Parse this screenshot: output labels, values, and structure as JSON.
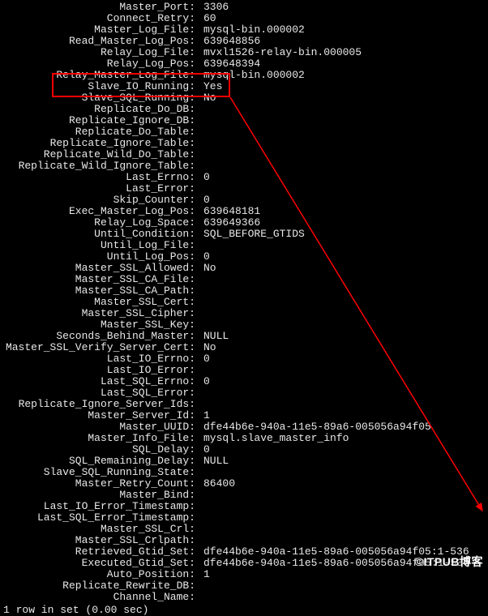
{
  "footer": "1 row in set (0.00 sec)",
  "watermark": "©ITPUB博客",
  "rows": [
    {
      "label": "Master_Port:",
      "value": "3306"
    },
    {
      "label": "Connect_Retry:",
      "value": "60"
    },
    {
      "label": "Master_Log_File:",
      "value": "mysql-bin.000002"
    },
    {
      "label": "Read_Master_Log_Pos:",
      "value": "639648856"
    },
    {
      "label": "Relay_Log_File:",
      "value": "mvxl1526-relay-bin.000005"
    },
    {
      "label": "Relay_Log_Pos:",
      "value": "639648394"
    },
    {
      "label": "Relay_Master_Log_File:",
      "value": "mysql-bin.000002"
    },
    {
      "label": "Slave_IO_Running:",
      "value": "Yes"
    },
    {
      "label": "Slave_SQL_Running:",
      "value": "No"
    },
    {
      "label": "Replicate_Do_DB:",
      "value": ""
    },
    {
      "label": "Replicate_Ignore_DB:",
      "value": ""
    },
    {
      "label": "Replicate_Do_Table:",
      "value": ""
    },
    {
      "label": "Replicate_Ignore_Table:",
      "value": ""
    },
    {
      "label": "Replicate_Wild_Do_Table:",
      "value": ""
    },
    {
      "label": "Replicate_Wild_Ignore_Table:",
      "value": ""
    },
    {
      "label": "Last_Errno:",
      "value": "0"
    },
    {
      "label": "Last_Error:",
      "value": ""
    },
    {
      "label": "Skip_Counter:",
      "value": "0"
    },
    {
      "label": "Exec_Master_Log_Pos:",
      "value": "639648181"
    },
    {
      "label": "Relay_Log_Space:",
      "value": "639649366"
    },
    {
      "label": "Until_Condition:",
      "value": "SQL_BEFORE_GTIDS"
    },
    {
      "label": "Until_Log_File:",
      "value": ""
    },
    {
      "label": "Until_Log_Pos:",
      "value": "0"
    },
    {
      "label": "Master_SSL_Allowed:",
      "value": "No"
    },
    {
      "label": "Master_SSL_CA_File:",
      "value": ""
    },
    {
      "label": "Master_SSL_CA_Path:",
      "value": ""
    },
    {
      "label": "Master_SSL_Cert:",
      "value": ""
    },
    {
      "label": "Master_SSL_Cipher:",
      "value": ""
    },
    {
      "label": "Master_SSL_Key:",
      "value": ""
    },
    {
      "label": "Seconds_Behind_Master:",
      "value": "NULL"
    },
    {
      "label": "Master_SSL_Verify_Server_Cert:",
      "value": "No"
    },
    {
      "label": "Last_IO_Errno:",
      "value": "0"
    },
    {
      "label": "Last_IO_Error:",
      "value": ""
    },
    {
      "label": "Last_SQL_Errno:",
      "value": "0"
    },
    {
      "label": "Last_SQL_Error:",
      "value": ""
    },
    {
      "label": "Replicate_Ignore_Server_Ids:",
      "value": ""
    },
    {
      "label": "Master_Server_Id:",
      "value": "1"
    },
    {
      "label": "Master_UUID:",
      "value": "dfe44b6e-940a-11e5-89a6-005056a94f05"
    },
    {
      "label": "Master_Info_File:",
      "value": "mysql.slave_master_info"
    },
    {
      "label": "SQL_Delay:",
      "value": "0"
    },
    {
      "label": "SQL_Remaining_Delay:",
      "value": "NULL"
    },
    {
      "label": "Slave_SQL_Running_State:",
      "value": ""
    },
    {
      "label": "Master_Retry_Count:",
      "value": "86400"
    },
    {
      "label": "Master_Bind:",
      "value": ""
    },
    {
      "label": "Last_IO_Error_Timestamp:",
      "value": ""
    },
    {
      "label": "Last_SQL_Error_Timestamp:",
      "value": ""
    },
    {
      "label": "Master_SSL_Crl:",
      "value": ""
    },
    {
      "label": "Master_SSL_Crlpath:",
      "value": ""
    },
    {
      "label": "Retrieved_Gtid_Set:",
      "value": "dfe44b6e-940a-11e5-89a6-005056a94f05:1-536"
    },
    {
      "label": "Executed_Gtid_Set:",
      "value": "dfe44b6e-940a-11e5-89a6-005056a94f05:1-534"
    },
    {
      "label": "Auto_Position:",
      "value": "1"
    },
    {
      "label": "Replicate_Rewrite_DB:",
      "value": ""
    },
    {
      "label": "Channel_Name:",
      "value": ""
    }
  ]
}
